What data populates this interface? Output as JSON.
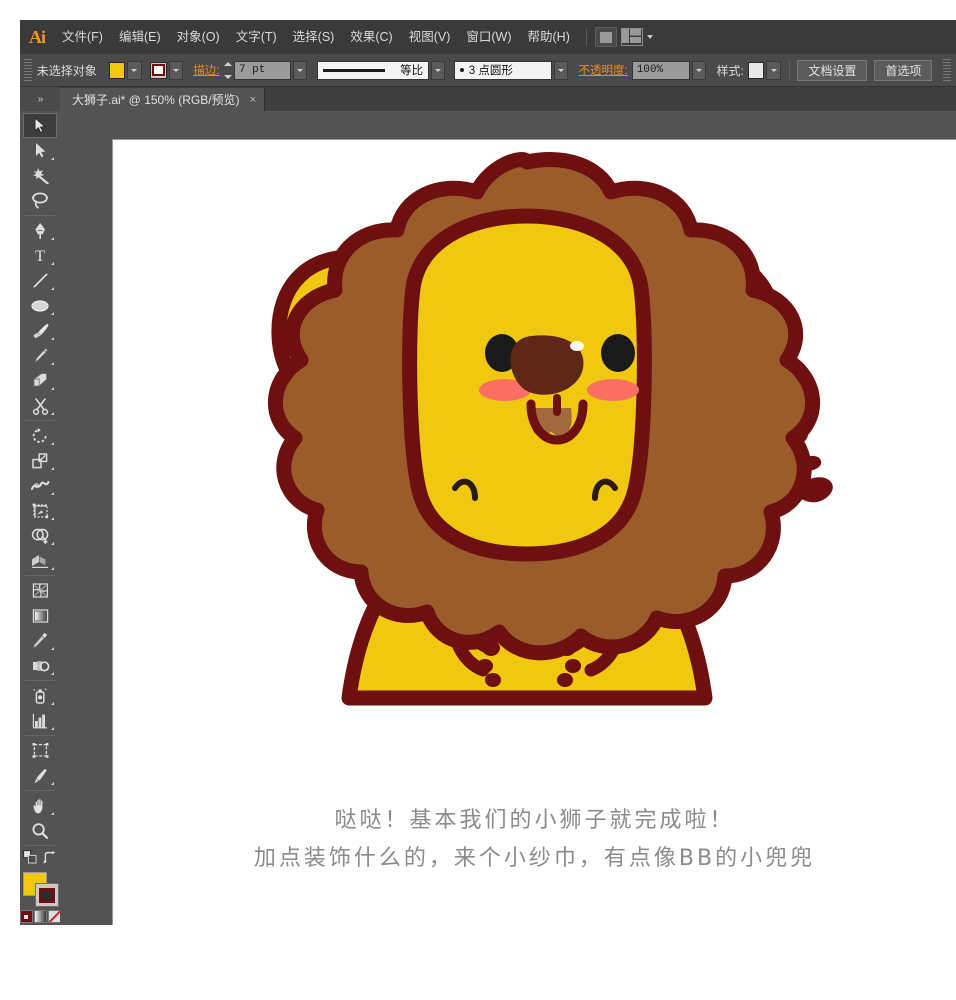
{
  "app": {
    "logo": "Ai",
    "name": "Adobe Illustrator"
  },
  "menubar": {
    "items": [
      {
        "label": "文件(F)",
        "name": "menu-file"
      },
      {
        "label": "编辑(E)",
        "name": "menu-edit"
      },
      {
        "label": "对象(O)",
        "name": "menu-object"
      },
      {
        "label": "文字(T)",
        "name": "menu-type"
      },
      {
        "label": "选择(S)",
        "name": "menu-select"
      },
      {
        "label": "效果(C)",
        "name": "menu-effect"
      },
      {
        "label": "视图(V)",
        "name": "menu-view"
      },
      {
        "label": "窗口(W)",
        "name": "menu-window"
      },
      {
        "label": "帮助(H)",
        "name": "menu-help"
      }
    ],
    "bridge_icon": "bridge-icon",
    "workspace_icon": "workspace-switcher-icon"
  },
  "controlbar": {
    "selection_status": "未选择对象",
    "fill_color": "#EFC80F",
    "stroke_color": "#6E1010",
    "stroke_label": "描边:",
    "stroke_weight": "7 pt",
    "stroke_profile": "等比",
    "brush_definition": "3 点圆形",
    "opacity_label": "不透明度:",
    "opacity_value": "100%",
    "style_label": "样式:",
    "document_setup": "文档设置",
    "preferences": "首选项"
  },
  "tabbar": {
    "collapse_label": "»",
    "document_title": "大狮子.ai* @ 150% (RGB/预览)",
    "close_label": "×"
  },
  "toolbar": {
    "tools": [
      {
        "name": "tool-selection",
        "label": "选择工具",
        "selected": true
      },
      {
        "name": "tool-direct-selection",
        "label": "直接选择工具",
        "selected": false
      },
      {
        "name": "tool-magic-wand",
        "label": "魔棒工具",
        "selected": false
      },
      {
        "name": "tool-lasso",
        "label": "套索工具",
        "selected": false
      },
      {
        "name": "tool-pen",
        "label": "钢笔工具",
        "selected": false
      },
      {
        "name": "tool-type",
        "label": "文字工具",
        "selected": false
      },
      {
        "name": "tool-line-segment",
        "label": "直线段工具",
        "selected": false
      },
      {
        "name": "tool-ellipse",
        "label": "椭圆工具",
        "selected": false
      },
      {
        "name": "tool-paintbrush",
        "label": "画笔工具",
        "selected": false
      },
      {
        "name": "tool-pencil",
        "label": "铅笔工具",
        "selected": false
      },
      {
        "name": "tool-blob-brush",
        "label": "斑点画笔工具",
        "selected": false
      },
      {
        "name": "tool-scissors",
        "label": "剪刀工具",
        "selected": false
      },
      {
        "name": "tool-rotate",
        "label": "旋转工具",
        "selected": false
      },
      {
        "name": "tool-scale",
        "label": "比例缩放工具",
        "selected": false
      },
      {
        "name": "tool-width",
        "label": "宽度工具",
        "selected": false
      },
      {
        "name": "tool-free-transform",
        "label": "自由变换工具",
        "selected": false
      },
      {
        "name": "tool-shape-builder",
        "label": "形状生成器工具",
        "selected": false
      },
      {
        "name": "tool-perspective-grid",
        "label": "透视网格工具",
        "selected": false
      },
      {
        "name": "tool-mesh",
        "label": "网格工具",
        "selected": false
      },
      {
        "name": "tool-gradient",
        "label": "渐变工具",
        "selected": false
      },
      {
        "name": "tool-eyedropper",
        "label": "吸管工具",
        "selected": false
      },
      {
        "name": "tool-blend",
        "label": "混合工具",
        "selected": false
      },
      {
        "name": "tool-symbol-sprayer",
        "label": "符号喷枪工具",
        "selected": false
      },
      {
        "name": "tool-column-graph",
        "label": "柱形图工具",
        "selected": false
      },
      {
        "name": "tool-artboard",
        "label": "画板工具",
        "selected": false
      },
      {
        "name": "tool-slice",
        "label": "切片工具",
        "selected": false
      },
      {
        "name": "tool-hand",
        "label": "抓手工具",
        "selected": false
      },
      {
        "name": "tool-zoom",
        "label": "缩放工具",
        "selected": false
      }
    ],
    "fill_swatch": "#EFC80F",
    "stroke_swatch": "#6E1010",
    "color_mode_icons": [
      "color-swatch-icon",
      "gradient-icon",
      "none-icon"
    ],
    "screen_mode": "screen-mode-icon"
  },
  "artwork": {
    "title": "小狮子卡通插画",
    "colors": {
      "outline": "#6E1010",
      "body_yellow": "#EFC80F",
      "mane_brown": "#9A5C2B",
      "inner_ear": "#B8762E",
      "nose": "#5E2718",
      "cheek": "#FA6F62",
      "eye": "#1A1A1A",
      "collar_green": "#3FB84A",
      "mouth": "#A06A3C"
    },
    "caption_line1": "哒哒！基本我们的小狮子就完成啦！",
    "caption_line2": "加点装饰什么的，来个小纱巾，有点像BB的小兜兜",
    "caption_color": "#8B8B8B"
  }
}
